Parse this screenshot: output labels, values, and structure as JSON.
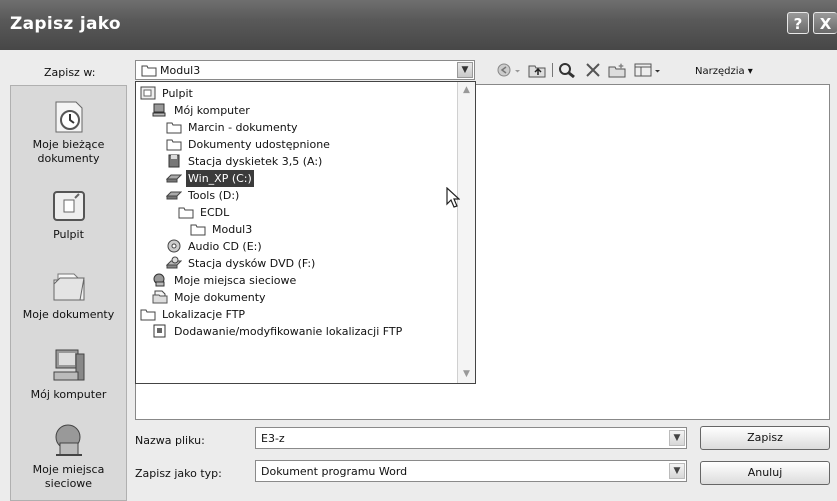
{
  "window": {
    "title": "Zapisz jako",
    "help_glyph": "?",
    "close_glyph": "X"
  },
  "save_in": {
    "label": "Zapisz w:",
    "value": "Modul3"
  },
  "toolbar": {
    "icons": [
      "back-icon",
      "up-folder-icon",
      "search-web-icon",
      "delete-icon",
      "new-folder-icon",
      "views-icon"
    ],
    "tools_label": "Narzędzia"
  },
  "places": [
    {
      "label": "Moje bieżące dokumenty",
      "icon": "recent-documents-icon"
    },
    {
      "label": "Pulpit",
      "icon": "desktop-icon"
    },
    {
      "label": "Moje dokumenty",
      "icon": "my-documents-icon"
    },
    {
      "label": "Mój komputer",
      "icon": "my-computer-icon"
    },
    {
      "label": "Moje miejsca sieciowe",
      "icon": "network-places-icon"
    }
  ],
  "dropdown": {
    "items": [
      {
        "label": "Pulpit",
        "icon": "desktop-icon"
      },
      {
        "label": "Mój komputer",
        "icon": "computer-icon"
      },
      {
        "label": "Marcin - dokumenty",
        "icon": "folder-icon"
      },
      {
        "label": "Dokumenty udostępnione",
        "icon": "folder-icon"
      },
      {
        "label": "Stacja dyskietek 3,5 (A:)",
        "icon": "floppy-icon"
      },
      {
        "label": "Win_XP (C:)",
        "icon": "drive-icon",
        "selected": true
      },
      {
        "label": "Tools (D:)",
        "icon": "drive-icon"
      },
      {
        "label": "ECDL",
        "icon": "folder-icon"
      },
      {
        "label": "Modul3",
        "icon": "folder-icon"
      },
      {
        "label": "Audio CD (E:)",
        "icon": "cd-icon"
      },
      {
        "label": "Stacja dysków DVD (F:)",
        "icon": "dvd-icon"
      },
      {
        "label": "Moje miejsca sieciowe",
        "icon": "network-icon"
      },
      {
        "label": "Moje dokumenty",
        "icon": "documents-icon"
      },
      {
        "label": "Lokalizacje FTP",
        "icon": "folder-icon"
      },
      {
        "label": "Dodawanie/modyfikowanie lokalizacji FTP",
        "icon": "ftp-add-icon"
      }
    ]
  },
  "filename": {
    "label": "Nazwa pliku:",
    "value": "E3-z"
  },
  "filetype": {
    "label": "Zapisz jako typ:",
    "value": "Dokument programu Word"
  },
  "buttons": {
    "save": "Zapisz",
    "cancel": "Anuluj"
  }
}
